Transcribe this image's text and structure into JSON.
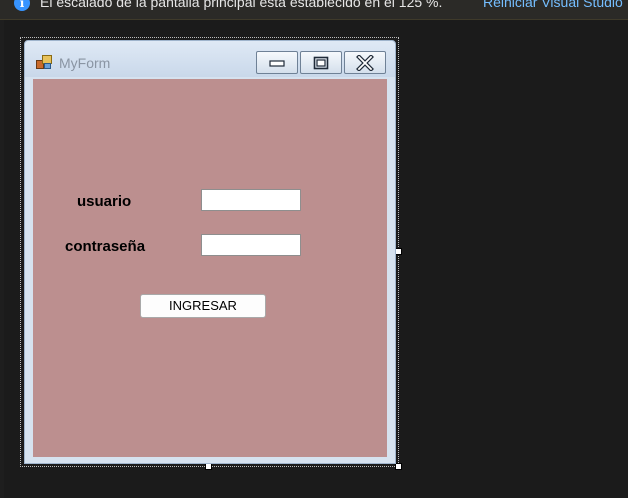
{
  "infobar": {
    "icon": "info-icon",
    "message": "El escalado de la pantalla principal está establecido en el 125 %.",
    "link": "Reiniciar Visual Studio"
  },
  "form": {
    "title": "MyForm",
    "app_icon": "winforms-app-icon",
    "client_color": "#bc8f8f",
    "controls": {
      "usuario_label": "usuario",
      "contrasena_label": "contraseña",
      "usuario_value": "",
      "contrasena_value": "",
      "submit_label": "INGRESAR"
    },
    "caption_buttons": [
      "minimize-icon",
      "maximize-icon",
      "close-icon"
    ]
  },
  "colors": {
    "ide_background": "#1e1e1e",
    "info_icon": "#3794ff",
    "link": "#75beff"
  }
}
